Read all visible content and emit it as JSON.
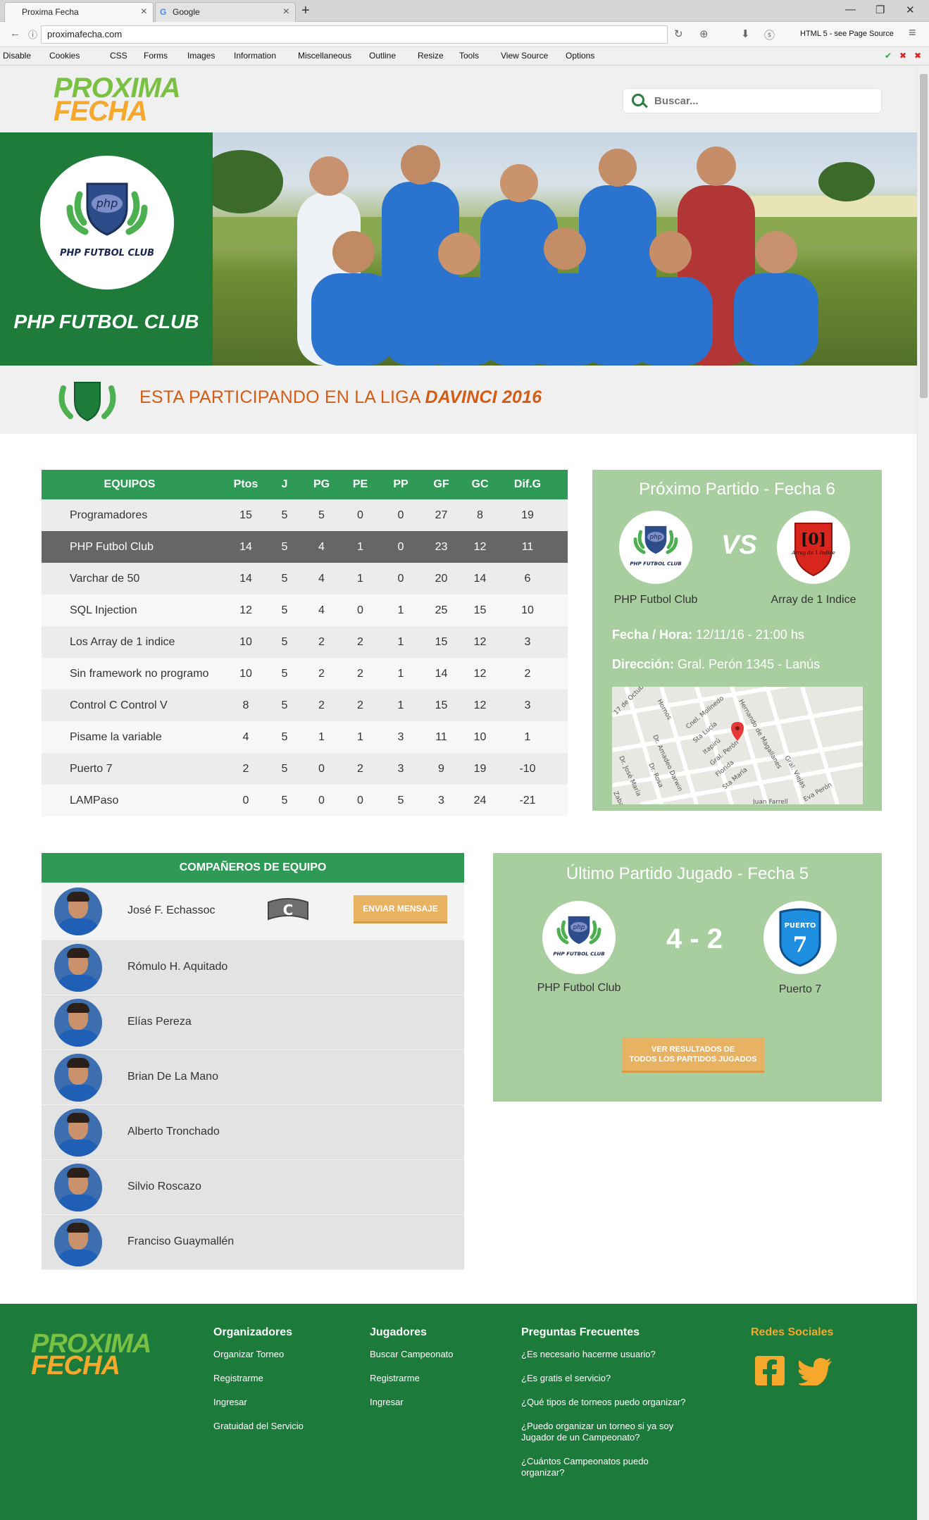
{
  "browser": {
    "tabs": [
      {
        "title": "Proxima Fecha"
      },
      {
        "title": "Google"
      }
    ],
    "new_tab": "+",
    "url": "proximafecha.com",
    "html_status": "HTML 5 - see Page Source",
    "toolbar": [
      "Disable",
      "Cookies",
      "CSS",
      "Forms",
      "Images",
      "Information",
      "Miscellaneous",
      "Outline",
      "Resize",
      "Tools",
      "View Source",
      "Options"
    ]
  },
  "brand": {
    "line1": "PROXIMA",
    "line2": "FECHA"
  },
  "search": {
    "placeholder": "Buscar..."
  },
  "club": {
    "name": "PHP FUTBOL CLUB",
    "badge_text": "php",
    "badge_caption": "PHP FUTBOL CLUB"
  },
  "league": {
    "prefix": "ESTA PARTICIPANDO EN LA LIGA",
    "name": "DAVINCI 2016"
  },
  "standings": {
    "headers": [
      "EQUIPOS",
      "Ptos",
      "J",
      "PG",
      "PE",
      "PP",
      "GF",
      "GC",
      "Dif.G"
    ],
    "rows": [
      [
        "Programadores",
        "15",
        "5",
        "5",
        "0",
        "0",
        "27",
        "8",
        "19"
      ],
      [
        "PHP Futbol Club",
        "14",
        "5",
        "4",
        "1",
        "0",
        "23",
        "12",
        "11"
      ],
      [
        "Varchar de 50",
        "14",
        "5",
        "4",
        "1",
        "0",
        "20",
        "14",
        "6"
      ],
      [
        "SQL Injection",
        "12",
        "5",
        "4",
        "0",
        "1",
        "25",
        "15",
        "10"
      ],
      [
        "Los Array de 1 indice",
        "10",
        "5",
        "2",
        "2",
        "1",
        "15",
        "12",
        "3"
      ],
      [
        "Sin framework no programo",
        "10",
        "5",
        "2",
        "2",
        "1",
        "14",
        "12",
        "2"
      ],
      [
        "Control C Control V",
        "8",
        "5",
        "2",
        "2",
        "1",
        "15",
        "12",
        "3"
      ],
      [
        "Pisame la variable",
        "4",
        "5",
        "1",
        "1",
        "3",
        "11",
        "10",
        "1"
      ],
      [
        "Puerto 7",
        "2",
        "5",
        "0",
        "2",
        "3",
        "9",
        "19",
        "-10"
      ],
      [
        "LAMPaso",
        "0",
        "5",
        "0",
        "0",
        "5",
        "3",
        "24",
        "-21"
      ]
    ]
  },
  "next_match": {
    "title": "Próximo Partido - Fecha 6",
    "vs": "VS",
    "home": "PHP Futbol Club",
    "away": "Array de 1 Indice",
    "away_badge_big": "[0]",
    "away_badge_small": "Array de 1 Indice",
    "datetime_label": "Fecha / Hora:",
    "datetime": "12/11/16 - 21:00 hs",
    "address_label": "Dirección:",
    "address": "Gral. Perón 1345 - Lanús",
    "map_labels": [
      "17 de Octubre",
      "Hornos",
      "Cnel. Molinedo",
      "Sta Lucía",
      "Itapirú",
      "Gral. Perón",
      "Florida",
      "Sta María",
      "Dr. Amadeo Darwin",
      "Dr. Rosa",
      "Dr. José María",
      "Hernando de Magallanes",
      "Gral. Viejas",
      "Eva Perón",
      "Juan Farrell",
      "Zabaleta"
    ]
  },
  "teammates": {
    "title": "COMPAÑEROS DE EQUIPO",
    "captain_mark": "C",
    "message_button": "ENVIAR MENSAJE",
    "list": [
      "José F. Echassoc",
      "Rómulo H. Aquitado",
      "Elías Pereza",
      "Brian De La Mano",
      "Alberto Tronchado",
      "Silvio Roscazo",
      "Franciso Guaymallén"
    ]
  },
  "last_match": {
    "title": "Último  Partido Jugado - Fecha 5",
    "score": "4 - 2",
    "home": "PHP Futbol Club",
    "away": "Puerto 7",
    "away_badge_top": "PUERTO",
    "away_badge_num": "7",
    "results_button_line1": "VER RESULTADOS DE",
    "results_button_line2": "TODOS LOS PARTIDOS JUGADOS"
  },
  "footer": {
    "organizers": {
      "title": "Organizadores",
      "links": [
        "Organizar Torneo",
        "Registrarme",
        "Ingresar",
        "Gratuidad del Servicio"
      ]
    },
    "players": {
      "title": "Jugadores",
      "links": [
        "Buscar Campeonato",
        "Registrarme",
        "Ingresar"
      ]
    },
    "faq": {
      "title": "Preguntas Frecuentes",
      "links": [
        "¿Es necesario hacerme usuario?",
        "¿Es gratis el servicio?",
        "¿Qué tipos de torneos puedo organizar?",
        "¿Puedo organizar un torneo si ya soy Jugador de un Campeonato?",
        "¿Cuántos Campeonatos puedo organizar?"
      ]
    },
    "social": {
      "title": "Redes Sociales"
    }
  },
  "colors": {
    "green_dark": "#1e7b3a",
    "green_header": "#2f9a55",
    "green_soft": "#a8cea0",
    "orange": "#f5a82c",
    "league_orange": "#d35d14",
    "button": "#e8b263"
  }
}
